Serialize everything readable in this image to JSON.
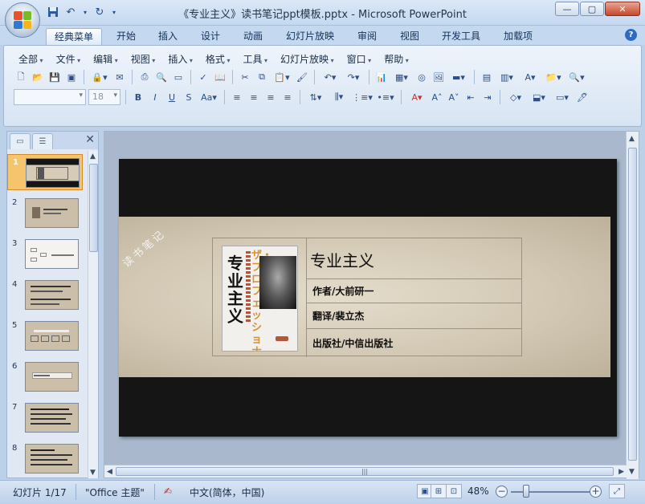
{
  "window": {
    "title": "《专业主义》读书笔记ppt模板.pptx - Microsoft PowerPoint",
    "buttons": {
      "minimize": "—",
      "maximize": "▢",
      "close": "✕"
    }
  },
  "quick_access": {
    "icons": [
      "save-icon",
      "undo-icon",
      "redo-icon",
      "customize-icon"
    ]
  },
  "tabs": [
    {
      "label": "经典菜单",
      "active": true
    },
    {
      "label": "开始"
    },
    {
      "label": "插入"
    },
    {
      "label": "设计"
    },
    {
      "label": "动画"
    },
    {
      "label": "幻灯片放映"
    },
    {
      "label": "审阅"
    },
    {
      "label": "视图"
    },
    {
      "label": "开发工具"
    },
    {
      "label": "加载项"
    }
  ],
  "menu": [
    {
      "label": "全部"
    },
    {
      "label": "文件"
    },
    {
      "label": "编辑"
    },
    {
      "label": "视图"
    },
    {
      "label": "插入"
    },
    {
      "label": "格式"
    },
    {
      "label": "工具"
    },
    {
      "label": "幻灯片放映"
    },
    {
      "label": "窗口"
    },
    {
      "label": "帮助"
    }
  ],
  "format": {
    "font_name_value": "",
    "font_size_value": "18"
  },
  "thumbnails": [
    {
      "num": "1"
    },
    {
      "num": "2"
    },
    {
      "num": "3"
    },
    {
      "num": "4"
    },
    {
      "num": "5"
    },
    {
      "num": "6"
    },
    {
      "num": "7"
    },
    {
      "num": "8"
    }
  ],
  "slide": {
    "watermark": "读书笔记",
    "book_title": "专业主义",
    "book_kana": "ザ・プロフェッショナル",
    "title": "专业主义",
    "author": "作者/大前研一",
    "translator": "翻译/裴立杰",
    "publisher": "出版社/中信出版社"
  },
  "status": {
    "slide_info": "幻灯片 1/17",
    "theme": "\"Office 主题\"",
    "language": "中文(简体，中国)",
    "zoom": "48%"
  }
}
